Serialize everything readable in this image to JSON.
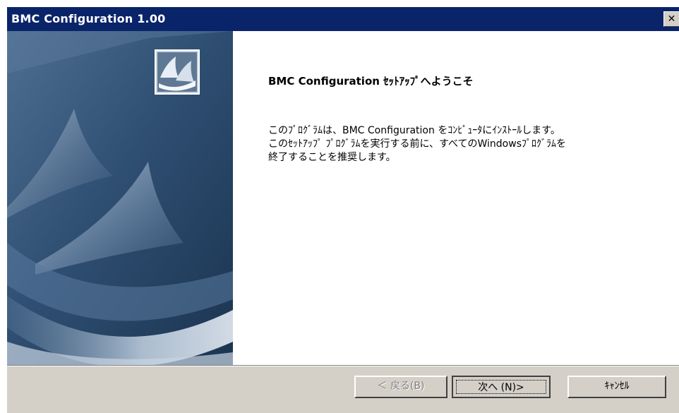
{
  "window": {
    "title": "BMC Configuration 1.00",
    "close_glyph": "✕"
  },
  "welcome": {
    "heading": "BMC Configuration ｾｯﾄｱｯﾌﾟへようこそ",
    "body_lines": [
      "このﾌﾟﾛｸﾞﾗﾑは、BMC Configuration をｺﾝﾋﾟｭｰﾀにｲﾝｽﾄｰﾙします。",
      "このｾｯﾄｱｯﾌﾟ ﾌﾟﾛｸﾞﾗﾑを実行する前に、すべてのWindowsﾌﾟﾛｸﾞﾗﾑを",
      "終了することを推奨します。"
    ]
  },
  "buttons": {
    "back": "＜ 戻る(B)",
    "next": "次へ (N)>",
    "cancel": "ｷｬﾝｾﾙ"
  },
  "icons": {
    "logo": "installer-logo-icon",
    "banner": "sail-banner-graphic"
  },
  "colors": {
    "titlebar": "#0a246a",
    "dialog_face": "#d4d0c8",
    "banner_dark": "#1f3b5c",
    "banner_light": "#6e8fb0"
  }
}
